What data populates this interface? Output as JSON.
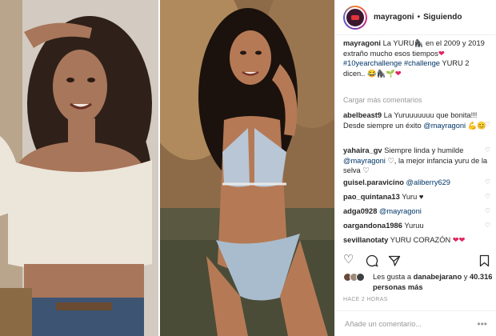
{
  "post": {
    "username": "mayragoni",
    "follow_status": "Siguiendo",
    "caption": {
      "author": "mayragoni",
      "text_1": "La YURU",
      "text_2": " en el 2009 y 2019 extraño mucho esos tiempos",
      "hashtags": "#10yearchallenge #challenge",
      "text_3": " YURU 2 dicen.."
    },
    "load_more": "Cargar más comentarios",
    "comments": [
      {
        "user": "abelbeast9",
        "text": "La Yuruuuuuuu que bonita!!! Desde siempre un éxito",
        "mention": "@mayragoni"
      },
      {
        "user": "yahaira_gv",
        "text": "Siempre linda y humilde",
        "mention": "@mayragoni",
        "text_2": ", la mejor infancia yuru de la selva"
      },
      {
        "user": "guisel.paravicino",
        "mention": "@aliberry629"
      },
      {
        "user": "pao_quintana13",
        "text": "Yuru"
      },
      {
        "user": "adga0928",
        "mention": "@mayragoni"
      },
      {
        "user": "oargandona1986",
        "text": "Yuruu"
      },
      {
        "user": "sevillanotaty",
        "text": "YURU CORAZÓN"
      }
    ],
    "likes": {
      "prefix": "Les gusta a",
      "liker": "danabejarano",
      "suffix": "y",
      "count": "40.316 personas más"
    },
    "timestamp": "HACE 2 HORAS",
    "comment_placeholder": "Añade un comentario...",
    "icons": {
      "like": "heart-icon",
      "comment": "speech-bubble-icon",
      "share": "paper-plane-icon",
      "save": "bookmark-icon",
      "more": "ellipsis-icon"
    }
  }
}
